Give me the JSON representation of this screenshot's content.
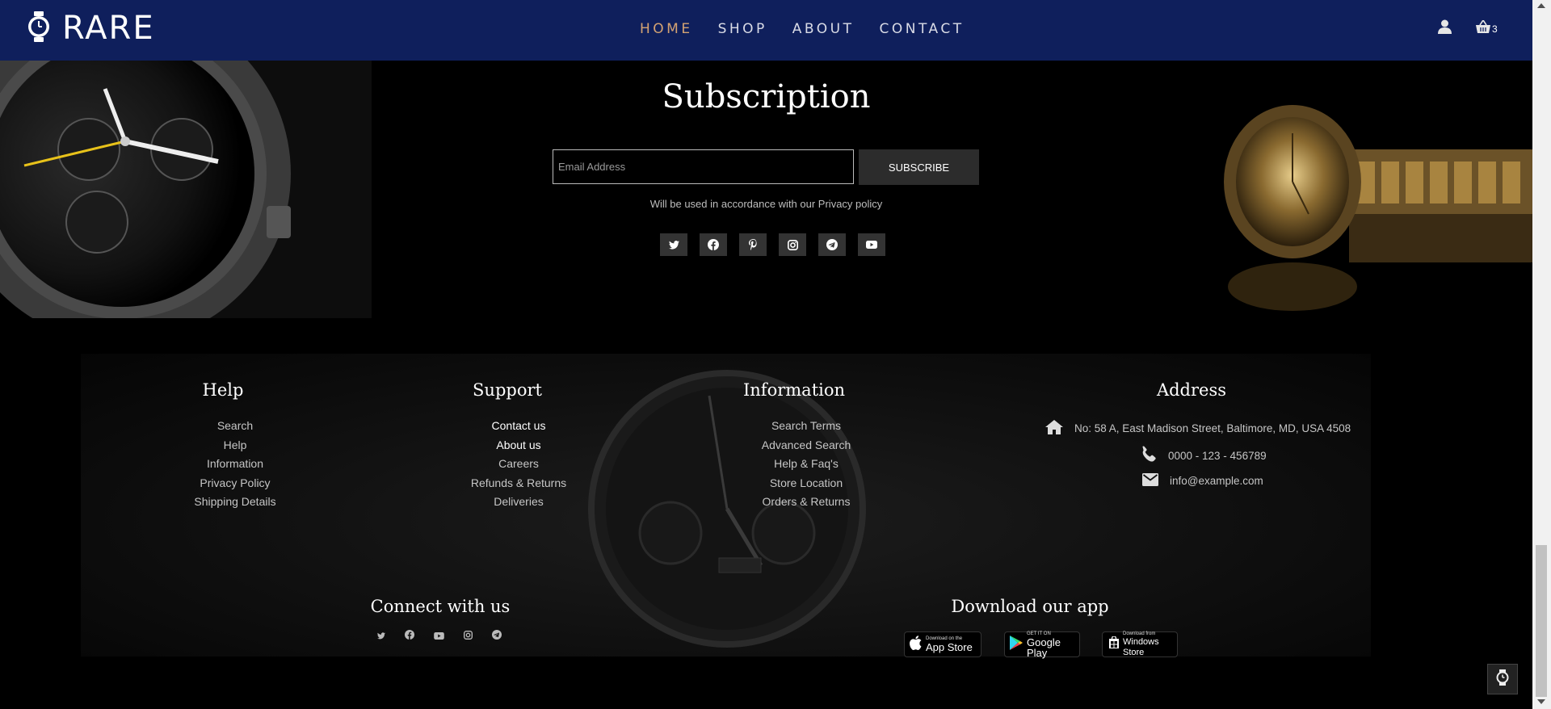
{
  "header": {
    "brand": "RARE",
    "nav": [
      "HOME",
      "SHOP",
      "ABOUT",
      "CONTACT"
    ],
    "cart_count": "3",
    "icons": [
      "watch-logo-icon",
      "user-icon",
      "basket-icon"
    ]
  },
  "subscription": {
    "title": "Subscription",
    "email_placeholder": "Email Address",
    "button": "SUBSCRIBE",
    "note": "Will be used in accordance with our Privacy policy",
    "social": [
      "twitter-icon",
      "facebook-icon",
      "pinterest-icon",
      "instagram-icon",
      "telegram-icon",
      "youtube-icon"
    ]
  },
  "footer": {
    "help": {
      "title": "Help",
      "items": [
        "Search",
        "Help",
        "Information",
        "Privacy Policy",
        "Shipping Details"
      ]
    },
    "support": {
      "title": "Support",
      "items": [
        "Contact us",
        "About us",
        "Careers",
        "Refunds & Returns",
        "Deliveries"
      ]
    },
    "information": {
      "title": "Information",
      "items": [
        "Search Terms",
        "Advanced Search",
        "Help & Faq's",
        "Store Location",
        "Orders & Returns"
      ]
    },
    "address": {
      "title": "Address",
      "street": "No: 58 A, East Madison Street, Baltimore, MD, USA 4508",
      "phone": "0000 - 123 - 456789",
      "email": "info@example.com"
    },
    "connect": {
      "title": "Connect with us",
      "icons": [
        "twitter-icon",
        "facebook-icon",
        "youtube-icon",
        "instagram-icon",
        "telegram-icon"
      ]
    },
    "download": {
      "title": "Download our app",
      "app_store_small": "Download on the",
      "app_store": "App Store",
      "google_small": "GET IT ON",
      "google": "Google Play",
      "windows_small": "Download from",
      "windows": "Windows Store"
    }
  },
  "colors": {
    "header_bg": "#0f1f5c",
    "nav_active": "#d4a373",
    "background": "#000000"
  }
}
